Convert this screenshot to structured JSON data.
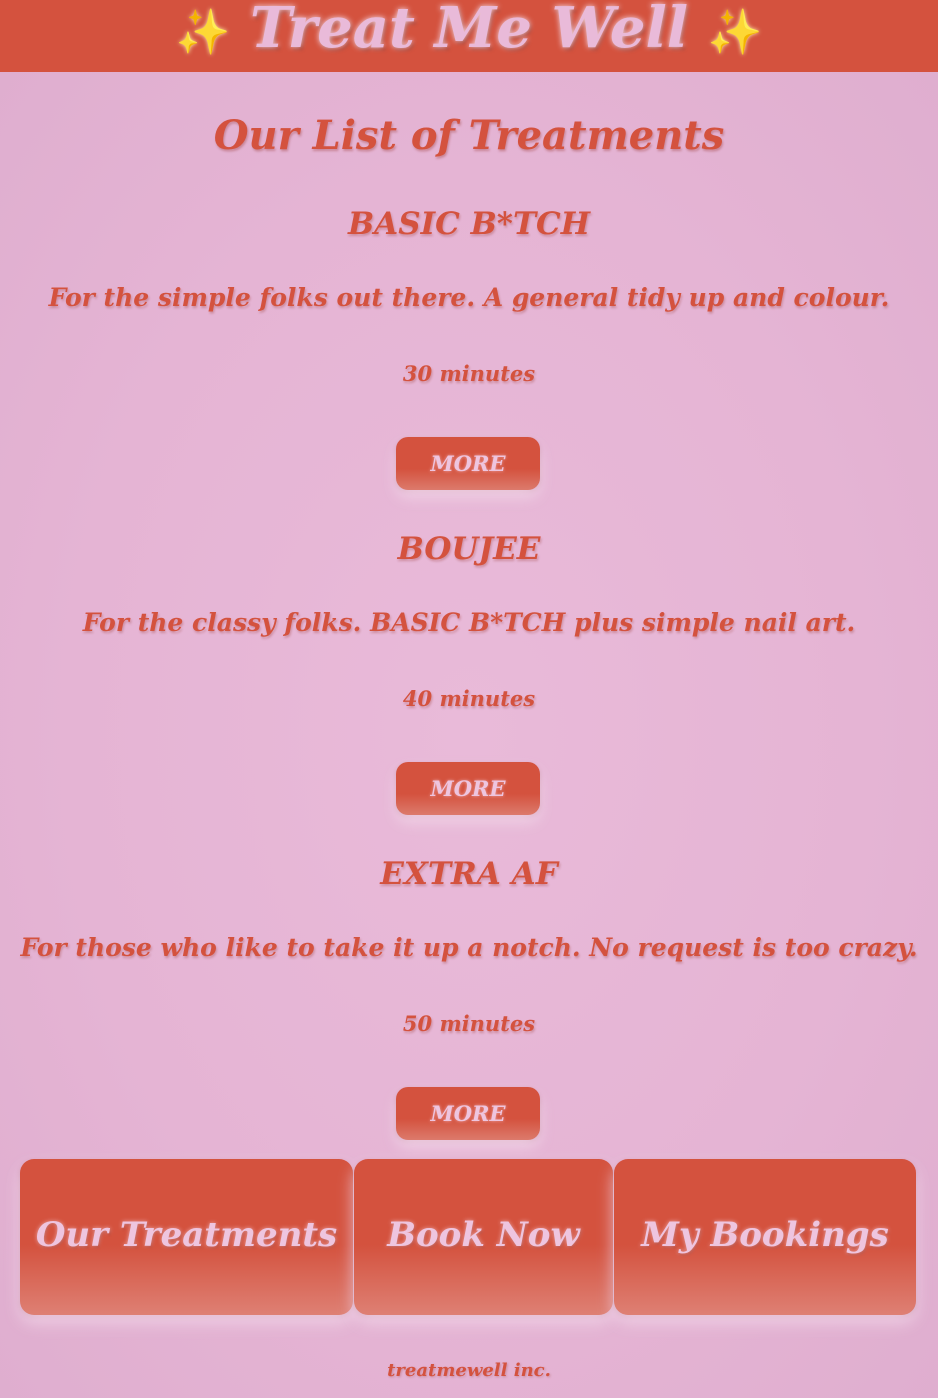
{
  "header": {
    "sparkle_left": "✨",
    "title": "Treat Me Well",
    "sparkle_right": "✨"
  },
  "main": {
    "heading": "Our List of Treatments",
    "treatments": [
      {
        "name": "BASIC B*TCH",
        "description": "For the simple folks out there. A general tidy up and colour.",
        "duration": "30 minutes",
        "button_label": "MORE"
      },
      {
        "name": "BOUJEE",
        "description": "For the classy folks. BASIC B*TCH plus simple nail art.",
        "duration": "40 minutes",
        "button_label": "MORE"
      },
      {
        "name": "EXTRA AF",
        "description": "For those who like to take it up a notch. No request is too crazy.",
        "duration": "50 minutes",
        "button_label": "MORE"
      }
    ]
  },
  "nav": {
    "items": [
      {
        "label": "Our Treatments"
      },
      {
        "label": "Book Now"
      },
      {
        "label": "My Bookings"
      }
    ]
  },
  "footer": {
    "text": "treatmewell inc."
  },
  "colors": {
    "accent": "#d4523e",
    "background": "#e6b7d6",
    "button_text": "#eec5df",
    "sparkle": "#f6d24a"
  }
}
